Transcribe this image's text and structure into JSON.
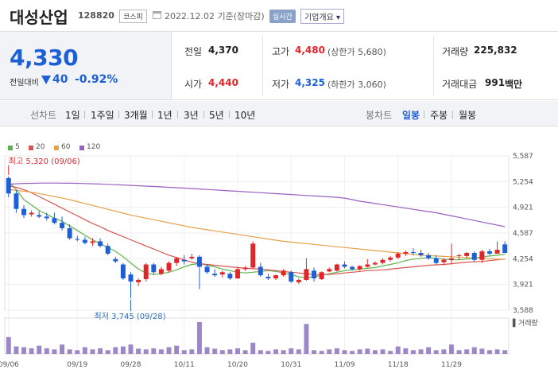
{
  "header": {
    "name": "대성산업",
    "code": "128820",
    "market": "코스피",
    "date": "2022.12.02 기준(장마감)",
    "realtime": "실시간",
    "overview": "기업개요"
  },
  "price": {
    "current": "4,330",
    "diff_label": "전일대비",
    "diff": "40",
    "rate": "-0.92%",
    "color_down": "#1c5fd6",
    "color_up": "#e0262b"
  },
  "stats": {
    "prev_label": "전일",
    "prev": "4,370",
    "high_label": "고가",
    "high": "4,480",
    "upper_limit": "(상한가 5,680)",
    "volume_label": "거래량",
    "volume": "225,832",
    "open_label": "시가",
    "open": "4,440",
    "low_label": "저가",
    "low": "4,325",
    "lower_limit": "(하한가 3,060)",
    "amount_label": "거래대금",
    "amount": "991",
    "amount_unit": "백만"
  },
  "toolbar": {
    "line_label": "선차트",
    "periods": [
      "1일",
      "1주일",
      "3개월",
      "1년",
      "3년",
      "5년",
      "10년"
    ],
    "candle_label": "봉차트",
    "candle_periods": [
      "일봉",
      "주봉",
      "월봉"
    ],
    "active_candle": "일봉"
  },
  "legend": [
    {
      "name": "5",
      "color": "#5fb24a"
    },
    {
      "name": "20",
      "color": "#d9534f"
    },
    {
      "name": "60",
      "color": "#e6a14a"
    },
    {
      "name": "120",
      "color": "#9a5fc0"
    }
  ],
  "chart_data": {
    "type": "candlestick",
    "y_ticks": [
      "5,587",
      "5,254",
      "4,921",
      "4,587",
      "4,254",
      "3,921",
      "3,588"
    ],
    "ylim": [
      3588,
      5587
    ],
    "x_ticks": [
      "09/06",
      "09/19",
      "09/28",
      "10/11",
      "10/20",
      "10/31",
      "11/09",
      "11/18",
      "11/29"
    ],
    "x_tick_index": [
      0,
      9,
      16,
      23,
      30,
      37,
      44,
      51,
      58
    ],
    "high_note": "최고 5,320 (09/06)",
    "high_index": 0,
    "high_value": 5320,
    "low_note": "최저 3,745 (09/28)",
    "low_index": 16,
    "low_value": 3745,
    "volume_label": "거래량",
    "candles": [
      [
        5300,
        5320,
        5050,
        5100
      ],
      [
        5100,
        5150,
        4850,
        4900
      ],
      [
        4900,
        4950,
        4780,
        4820
      ],
      [
        4830,
        4880,
        4800,
        4850
      ],
      [
        4820,
        4870,
        4780,
        4800
      ],
      [
        4800,
        4850,
        4750,
        4780
      ],
      [
        4780,
        4850,
        4700,
        4720
      ],
      [
        4720,
        4800,
        4620,
        4650
      ],
      [
        4650,
        4700,
        4500,
        4520
      ],
      [
        4510,
        4550,
        4480,
        4500
      ],
      [
        4500,
        4540,
        4440,
        4460
      ],
      [
        4460,
        4520,
        4420,
        4480
      ],
      [
        4480,
        4520,
        4400,
        4420
      ],
      [
        4420,
        4450,
        4300,
        4320
      ],
      [
        4250,
        4280,
        4200,
        4220
      ],
      [
        4180,
        4200,
        3980,
        4000
      ],
      [
        4050,
        4080,
        3745,
        3960
      ],
      [
        3950,
        4000,
        3900,
        3980
      ],
      [
        3990,
        4200,
        3960,
        4180
      ],
      [
        4180,
        4200,
        4050,
        4080
      ],
      [
        4060,
        4150,
        4040,
        4120
      ],
      [
        4100,
        4220,
        4080,
        4200
      ],
      [
        4200,
        4280,
        4160,
        4260
      ],
      [
        4240,
        4300,
        4180,
        4220
      ],
      [
        4260,
        4320,
        4240,
        4280
      ],
      [
        4280,
        4300,
        3860,
        4150
      ],
      [
        4150,
        4180,
        4060,
        4080
      ],
      [
        4060,
        4120,
        4020,
        4040
      ],
      [
        4050,
        4100,
        4010,
        4080
      ],
      [
        4060,
        4080,
        3980,
        4000
      ],
      [
        4000,
        4150,
        3990,
        4120
      ],
      [
        4120,
        4160,
        4100,
        4140
      ],
      [
        4140,
        4480,
        4130,
        4450
      ],
      [
        4150,
        4200,
        4020,
        4040
      ],
      [
        4020,
        4060,
        3980,
        4000
      ],
      [
        4000,
        4050,
        3980,
        4040
      ],
      [
        4040,
        4120,
        4020,
        4100
      ],
      [
        4080,
        4100,
        3940,
        3960
      ],
      [
        3950,
        4000,
        3930,
        3980
      ],
      [
        3980,
        4260,
        3970,
        4120
      ],
      [
        4100,
        4140,
        3960,
        4000
      ],
      [
        3990,
        4090,
        3980,
        4080
      ],
      [
        4090,
        4140,
        4080,
        4120
      ],
      [
        4100,
        4190,
        4090,
        4180
      ],
      [
        4180,
        4220,
        4130,
        4150
      ],
      [
        4150,
        4160,
        4100,
        4120
      ],
      [
        4120,
        4170,
        4100,
        4160
      ],
      [
        4150,
        4250,
        4140,
        4180
      ],
      [
        4180,
        4220,
        4170,
        4200
      ],
      [
        4200,
        4260,
        4180,
        4240
      ],
      [
        4240,
        4290,
        4220,
        4270
      ],
      [
        4270,
        4340,
        4250,
        4320
      ],
      [
        4320,
        4360,
        4290,
        4340
      ],
      [
        4340,
        4390,
        4300,
        4330
      ],
      [
        4330,
        4370,
        4280,
        4300
      ],
      [
        4300,
        4330,
        4240,
        4260
      ],
      [
        4260,
        4300,
        4180,
        4200
      ],
      [
        4210,
        4260,
        4170,
        4240
      ],
      [
        4240,
        4450,
        4180,
        4260
      ],
      [
        4300,
        4320,
        4240,
        4300
      ],
      [
        4290,
        4340,
        4260,
        4330
      ],
      [
        4330,
        4350,
        4210,
        4240
      ],
      [
        4240,
        4370,
        4200,
        4350
      ],
      [
        4350,
        4380,
        4300,
        4320
      ],
      [
        4320,
        4480,
        4325,
        4370
      ],
      [
        4440,
        4480,
        4325,
        4330
      ]
    ],
    "volumes": [
      45,
      20,
      18,
      15,
      22,
      15,
      12,
      25,
      12,
      10,
      18,
      12,
      15,
      10,
      18,
      20,
      25,
      14,
      12,
      15,
      12,
      18,
      22,
      10,
      12,
      85,
      18,
      14,
      10,
      12,
      15,
      10,
      30,
      10,
      8,
      12,
      10,
      15,
      12,
      80,
      10,
      8,
      12,
      15,
      10,
      8,
      12,
      14,
      10,
      12,
      8,
      20,
      15,
      10,
      12,
      18,
      10,
      12,
      25,
      10,
      12,
      18,
      14,
      10,
      12,
      10
    ],
    "series": [
      {
        "name": "5",
        "values": [
          5250,
          5150,
          5020,
          4950,
          4880,
          4830,
          4780,
          4740,
          4680,
          4620,
          4560,
          4500,
          4450,
          4400,
          4350,
          4280,
          4200,
          4120,
          4070,
          4050,
          4060,
          4080,
          4110,
          4150,
          4180,
          4190,
          4170,
          4150,
          4120,
          4100,
          4080,
          4070,
          4080,
          4090,
          4100,
          4090,
          4070,
          4050,
          4020,
          4010,
          4020,
          4040,
          4060,
          4080,
          4100,
          4110,
          4120,
          4130,
          4140,
          4160,
          4180,
          4200,
          4230,
          4250,
          4260,
          4270,
          4260,
          4250,
          4240,
          4240,
          4250,
          4260,
          4280,
          4290,
          4300,
          4310
        ]
      },
      {
        "name": "20",
        "values": [
          5200,
          5180,
          5150,
          5110,
          5060,
          5010,
          4960,
          4910,
          4860,
          4810,
          4760,
          4710,
          4670,
          4620,
          4580,
          4540,
          4500,
          4460,
          4420,
          4380,
          4340,
          4300,
          4270,
          4240,
          4210,
          4190,
          4180,
          4170,
          4160,
          4150,
          4140,
          4130,
          4125,
          4120,
          4110,
          4100,
          4090,
          4080,
          4070,
          4060,
          4050,
          4050,
          4050,
          4060,
          4070,
          4080,
          4090,
          4100,
          4105,
          4110,
          4120,
          4130,
          4140,
          4150,
          4160,
          4170,
          4175,
          4180,
          4190,
          4200,
          4210,
          4215,
          4220,
          4230,
          4240,
          4250
        ]
      },
      {
        "name": "60",
        "values": [
          5150,
          5140,
          5130,
          5115,
          5100,
          5080,
          5060,
          5040,
          5020,
          4995,
          4970,
          4945,
          4920,
          4895,
          4870,
          4845,
          4820,
          4800,
          4780,
          4760,
          4740,
          4720,
          4700,
          4680,
          4660,
          4645,
          4630,
          4615,
          4600,
          4585,
          4570,
          4555,
          4540,
          4525,
          4510,
          4495,
          4480,
          4470,
          4460,
          4450,
          4440,
          4430,
          4420,
          4410,
          4400,
          4390,
          4380,
          4370,
          4360,
          4350,
          4340,
          4330,
          4320,
          4310,
          4300,
          4295,
          4290,
          4285,
          4280,
          4275,
          4270,
          4265,
          4260,
          4255,
          4250,
          4245
        ]
      },
      {
        "name": "120",
        "values": [
          5220,
          5225,
          5230,
          5232,
          5234,
          5235,
          5235,
          5234,
          5233,
          5231,
          5228,
          5225,
          5222,
          5218,
          5214,
          5210,
          5205,
          5200,
          5195,
          5190,
          5185,
          5180,
          5175,
          5170,
          5164,
          5158,
          5152,
          5146,
          5140,
          5134,
          5128,
          5122,
          5116,
          5110,
          5104,
          5098,
          5092,
          5086,
          5080,
          5074,
          5068,
          5062,
          5056,
          5050,
          5040,
          5020,
          5000,
          4985,
          4970,
          4955,
          4940,
          4925,
          4910,
          4895,
          4880,
          4865,
          4850,
          4830,
          4810,
          4790,
          4770,
          4750,
          4730,
          4710,
          4690,
          4670
        ]
      }
    ]
  }
}
